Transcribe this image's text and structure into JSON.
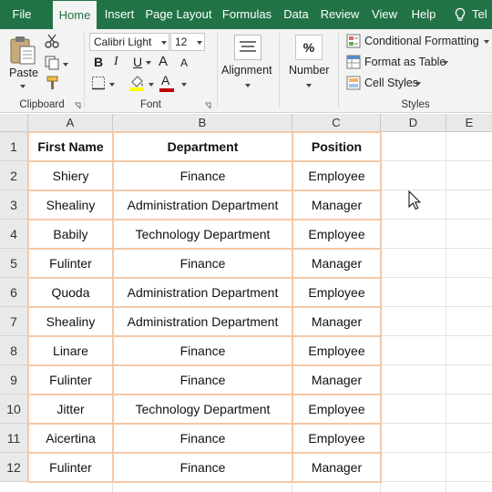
{
  "ribbon_tabs": [
    "File",
    "Home",
    "Insert",
    "Page Layout",
    "Formulas",
    "Data",
    "Review",
    "View",
    "Help",
    "Tel"
  ],
  "active_tab": "Home",
  "clipboard": {
    "paste": "Paste",
    "group": "Clipboard"
  },
  "font": {
    "name": "Calibri Light",
    "size": "12",
    "bold": "B",
    "italic": "I",
    "underline": "U",
    "grow": "A",
    "shrink": "A",
    "font_color_letter": "A",
    "group": "Font"
  },
  "alignment": {
    "label": "Alignment"
  },
  "number": {
    "label": "Number",
    "icon_text": "%"
  },
  "styles": {
    "conditional": "Conditional Formatting",
    "format_table": "Format as Table",
    "cell_styles": "Cell Styles",
    "group": "Styles"
  },
  "colors": {
    "accent": "#217346",
    "highlight": "#FFFF00",
    "font_color": "#C00000",
    "table_border": "#F4C8A6"
  },
  "columns": [
    "A",
    "B",
    "C",
    "D",
    "E"
  ],
  "rows": [
    "1",
    "2",
    "3",
    "4",
    "5",
    "6",
    "7",
    "8",
    "9",
    "10",
    "11",
    "12"
  ],
  "table": {
    "headers": [
      "First Name",
      "Department",
      "Position"
    ],
    "rows": [
      [
        "Shiery",
        "Finance",
        "Employee"
      ],
      [
        "Shealiny",
        "Administration Department",
        "Manager"
      ],
      [
        "Babily",
        "Technology Department",
        "Employee"
      ],
      [
        "Fulinter",
        "Finance",
        "Manager"
      ],
      [
        "Quoda",
        "Administration Department",
        "Employee"
      ],
      [
        "Shealiny",
        "Administration Department",
        "Manager"
      ],
      [
        "Linare",
        "Finance",
        "Employee"
      ],
      [
        "Fulinter",
        "Finance",
        "Manager"
      ],
      [
        "Jitter",
        "Technology Department",
        "Employee"
      ],
      [
        "Aicertina",
        "Finance",
        "Employee"
      ],
      [
        "Fulinter",
        "Finance",
        "Manager"
      ]
    ]
  }
}
